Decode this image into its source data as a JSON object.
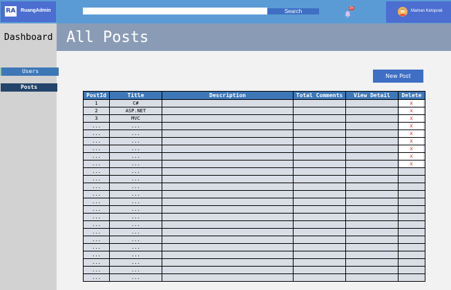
{
  "brand": {
    "logo": "RA",
    "name": "RuangAdmin"
  },
  "search": {
    "placeholder": "",
    "button_label": "Search"
  },
  "notifications": {
    "badge": "3+"
  },
  "user": {
    "name": "Maman Ketoprak"
  },
  "sidebar": {
    "title": "Dashboard",
    "items": [
      {
        "label": "Users"
      },
      {
        "label": "Posts"
      }
    ]
  },
  "page": {
    "title": "All Posts"
  },
  "actions": {
    "new_post_label": "New Post"
  },
  "table": {
    "columns": [
      "PostId",
      "Title",
      "Description",
      "Total Comments",
      "View Detail",
      "Delete"
    ],
    "rows": [
      {
        "id": "1",
        "title": "C#",
        "description": "",
        "comments": "",
        "detail": "",
        "delete": "x"
      },
      {
        "id": "2",
        "title": "ASP.NET",
        "description": "",
        "comments": "",
        "detail": "",
        "delete": "x"
      },
      {
        "id": "3",
        "title": "MVC",
        "description": "",
        "comments": "",
        "detail": "",
        "delete": "x"
      },
      {
        "id": "...",
        "title": "...",
        "description": "",
        "comments": "",
        "detail": "",
        "delete": "x"
      },
      {
        "id": "...",
        "title": "...",
        "description": "",
        "comments": "",
        "detail": "",
        "delete": "x"
      },
      {
        "id": "...",
        "title": "...",
        "description": "",
        "comments": "",
        "detail": "",
        "delete": "x"
      },
      {
        "id": "...",
        "title": "...",
        "description": "",
        "comments": "",
        "detail": "",
        "delete": "x"
      },
      {
        "id": "...",
        "title": "...",
        "description": "",
        "comments": "",
        "detail": "",
        "delete": "x"
      },
      {
        "id": "...",
        "title": "...",
        "description": "",
        "comments": "",
        "detail": "",
        "delete": "x"
      },
      {
        "id": "...",
        "title": "...",
        "description": "",
        "comments": "",
        "detail": "",
        "delete": ""
      },
      {
        "id": "...",
        "title": "...",
        "description": "",
        "comments": "",
        "detail": "",
        "delete": ""
      },
      {
        "id": "...",
        "title": "...",
        "description": "",
        "comments": "",
        "detail": "",
        "delete": ""
      },
      {
        "id": "...",
        "title": "...",
        "description": "",
        "comments": "",
        "detail": "",
        "delete": ""
      },
      {
        "id": "...",
        "title": "...",
        "description": "",
        "comments": "",
        "detail": "",
        "delete": ""
      },
      {
        "id": "...",
        "title": "...",
        "description": "",
        "comments": "",
        "detail": "",
        "delete": ""
      },
      {
        "id": "...",
        "title": "...",
        "description": "",
        "comments": "",
        "detail": "",
        "delete": ""
      },
      {
        "id": "...",
        "title": "...",
        "description": "",
        "comments": "",
        "detail": "",
        "delete": ""
      },
      {
        "id": "...",
        "title": "...",
        "description": "",
        "comments": "",
        "detail": "",
        "delete": ""
      },
      {
        "id": "...",
        "title": "...",
        "description": "",
        "comments": "",
        "detail": "",
        "delete": ""
      },
      {
        "id": "...",
        "title": "...",
        "description": "",
        "comments": "",
        "detail": "",
        "delete": ""
      },
      {
        "id": "...",
        "title": "...",
        "description": "",
        "comments": "",
        "detail": "",
        "delete": ""
      },
      {
        "id": "...",
        "title": "...",
        "description": "",
        "comments": "",
        "detail": "",
        "delete": ""
      },
      {
        "id": "...",
        "title": "...",
        "description": "",
        "comments": "",
        "detail": "",
        "delete": ""
      },
      {
        "id": "...",
        "title": "...",
        "description": "",
        "comments": "",
        "detail": "",
        "delete": ""
      }
    ]
  },
  "colors": {
    "topbar": "#5b9bd5",
    "brand_bg": "#4b6ed0",
    "accent": "#3e6fc4",
    "header": "#8a9cb5",
    "sidebar": "#d2d2d2",
    "nav_active": "#24456a",
    "table_header": "#3d77b8",
    "table_cell": "#d9dde6",
    "delete_x": "#e03030"
  },
  "icons": {
    "bell": "bell-icon",
    "avatar": "user-avatar-icon",
    "delete": "delete-x-icon"
  }
}
